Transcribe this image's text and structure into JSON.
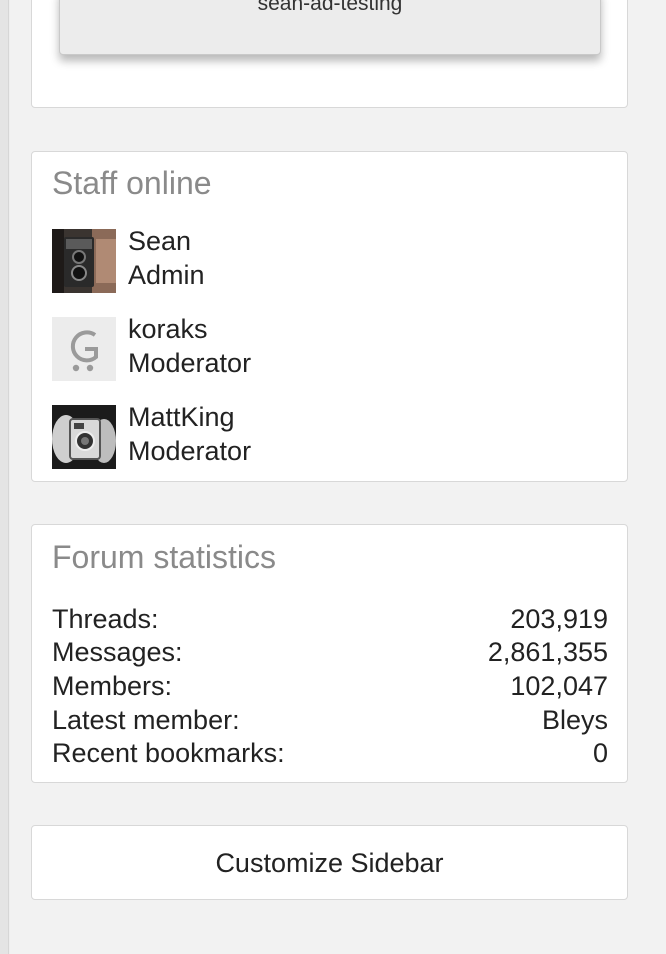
{
  "ad": {
    "button_label": "sean-ad-testing"
  },
  "staff": {
    "title": "Staff online",
    "members": [
      {
        "name": "Sean",
        "role": "Admin",
        "avatar": "camera-photo-avatar"
      },
      {
        "name": "koraks",
        "role": "Moderator",
        "avatar": "letter-g-avatar"
      },
      {
        "name": "MattKing",
        "role": "Moderator",
        "avatar": "hands-camera-avatar"
      }
    ]
  },
  "stats": {
    "title": "Forum statistics",
    "rows": [
      {
        "label": "Threads:",
        "value": "203,919"
      },
      {
        "label": "Messages:",
        "value": "2,861,355"
      },
      {
        "label": "Members:",
        "value": "102,047"
      },
      {
        "label": "Latest member:",
        "value": "Bleys"
      },
      {
        "label": "Recent bookmarks:",
        "value": "0"
      }
    ]
  },
  "customize": {
    "label": "Customize Sidebar"
  },
  "colors": {
    "title_gray": "#8a8a8a",
    "card_bg": "#ffffff",
    "page_bg": "#f2f2f2"
  }
}
